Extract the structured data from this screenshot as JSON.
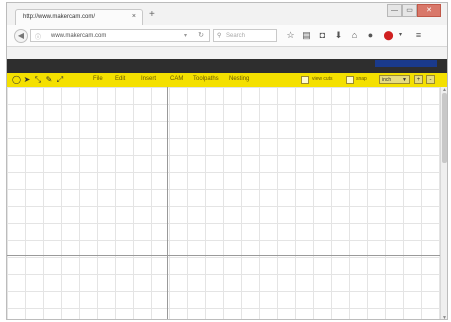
{
  "browser": {
    "tab_title": "http://www.makercam.com/",
    "tab_close": "×",
    "new_tab": "+",
    "url": "www.makercam.com",
    "search_placeholder": "Search",
    "window_controls": [
      "—",
      "▭",
      "✕"
    ],
    "toolbar_icons": [
      "star-icon",
      "reading-list-icon",
      "pocket-icon",
      "download-icon",
      "home-icon",
      "chat-icon",
      "adblock-icon",
      "menu-icon"
    ]
  },
  "app": {
    "tools": [
      "circle-tool-icon",
      "pointer-tool-icon",
      "node-tool-icon",
      "pen-tool-icon",
      "point-tool-icon"
    ],
    "menus": [
      "File",
      "Edit",
      "Insert",
      "CAM",
      "Toolpaths",
      "Nesting"
    ],
    "view_cuts_label": "view cuts",
    "snap_label": "snap",
    "units_value": "inch",
    "zoom_in": "+",
    "zoom_out": "-"
  }
}
